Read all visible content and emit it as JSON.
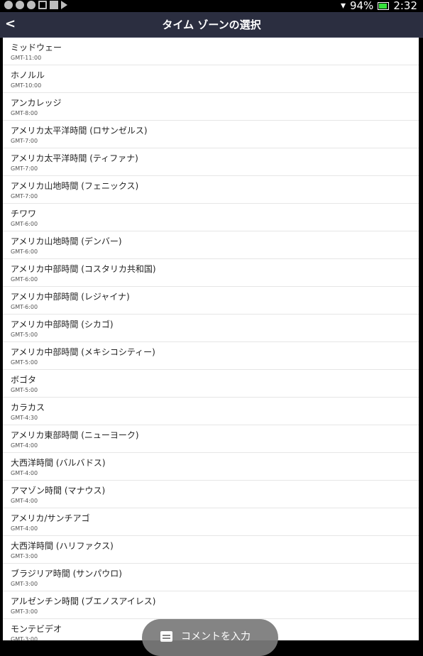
{
  "status_bar": {
    "left_icons": [
      "notification-icon-1",
      "notification-icon-2",
      "notification-icon-3",
      "chat-icon",
      "image-icon",
      "send-icon"
    ],
    "battery_percent": "94%",
    "battery_level": 0.94,
    "time": "2:32"
  },
  "app_bar": {
    "back_label": "<",
    "title": "タイム ゾーンの選択"
  },
  "timezones": [
    {
      "name": "ミッドウェー",
      "offset": "GMT-11:00"
    },
    {
      "name": "ホノルル",
      "offset": "GMT-10:00"
    },
    {
      "name": "アンカレッジ",
      "offset": "GMT-8:00"
    },
    {
      "name": "アメリカ太平洋時間 (ロサンゼルス)",
      "offset": "GMT-7:00"
    },
    {
      "name": "アメリカ太平洋時間 (ティファナ)",
      "offset": "GMT-7:00"
    },
    {
      "name": "アメリカ山地時間 (フェニックス)",
      "offset": "GMT-7:00"
    },
    {
      "name": "チワワ",
      "offset": "GMT-6:00"
    },
    {
      "name": "アメリカ山地時間 (デンバー)",
      "offset": "GMT-6:00"
    },
    {
      "name": "アメリカ中部時間 (コスタリカ共和国)",
      "offset": "GMT-6:00"
    },
    {
      "name": "アメリカ中部時間 (レジャイナ)",
      "offset": "GMT-6:00"
    },
    {
      "name": "アメリカ中部時間 (シカゴ)",
      "offset": "GMT-5:00"
    },
    {
      "name": "アメリカ中部時間 (メキシコシティー)",
      "offset": "GMT-5:00"
    },
    {
      "name": "ボゴタ",
      "offset": "GMT-5:00"
    },
    {
      "name": "カラカス",
      "offset": "GMT-4:30"
    },
    {
      "name": "アメリカ東部時間 (ニューヨーク)",
      "offset": "GMT-4:00"
    },
    {
      "name": "大西洋時間 (バルバドス)",
      "offset": "GMT-4:00"
    },
    {
      "name": "アマゾン時間 (マナウス)",
      "offset": "GMT-4:00"
    },
    {
      "name": "アメリカ/サンチアゴ",
      "offset": "GMT-4:00"
    },
    {
      "name": "大西洋時間 (ハリファクス)",
      "offset": "GMT-3:00"
    },
    {
      "name": "ブラジリア時間 (サンパウロ)",
      "offset": "GMT-3:00"
    },
    {
      "name": "アルゼンチン時間 (ブエノスアイレス)",
      "offset": "GMT-3:00"
    },
    {
      "name": "モンテビデオ",
      "offset": "GMT-3:00"
    }
  ],
  "comment_button": {
    "label": "コメントを入力",
    "icon": "comment-icon"
  }
}
